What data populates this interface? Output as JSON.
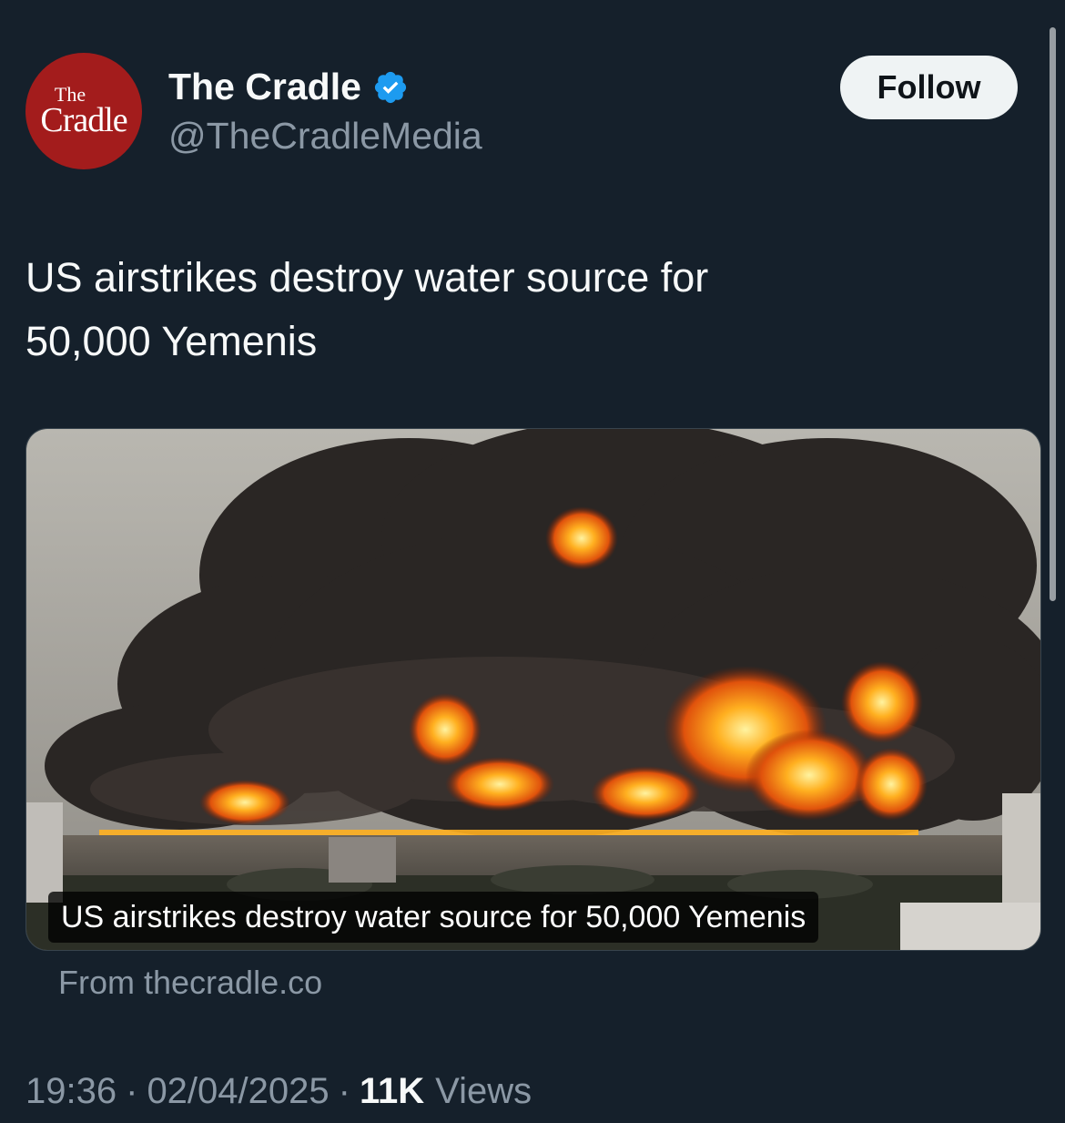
{
  "author": {
    "avatar_text_small": "The",
    "avatar_text_brand": "Cradle",
    "display_name": "The Cradle",
    "handle": "@TheCradleMedia",
    "verified_icon": "verified-badge-icon",
    "avatar_color": "#a31c1c"
  },
  "follow_button": {
    "label": "Follow"
  },
  "tweet": {
    "text_line1": "US airstrikes destroy water source for",
    "text_line2": "50,000 Yemenis"
  },
  "link_card": {
    "caption": "US airstrikes destroy water source for 50,000 Yemenis",
    "source": "From thecradle.co"
  },
  "meta": {
    "time": "19:36",
    "date": "02/04/2025",
    "views_count": "11K",
    "views_label": "Views",
    "separator": "·"
  },
  "colors": {
    "background": "#15202b",
    "verified_blue": "#1d9bf0",
    "muted_text": "#8b98a5"
  }
}
